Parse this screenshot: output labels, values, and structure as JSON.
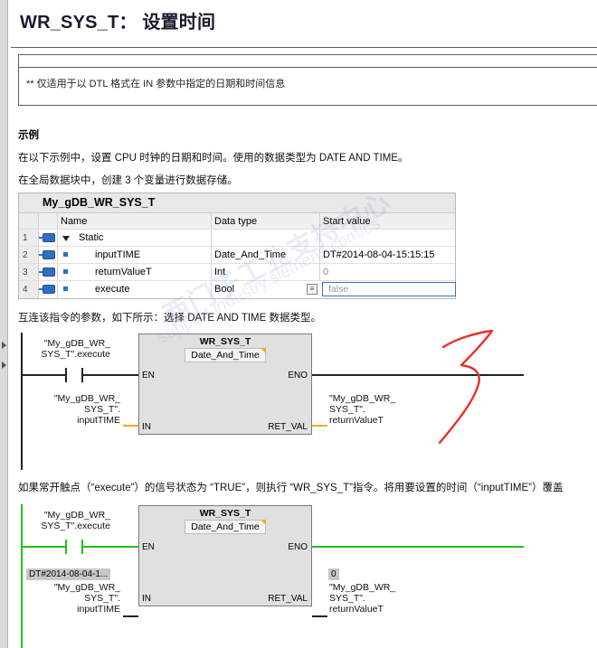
{
  "title": "WR_SYS_T： 设置时间",
  "note": "** 仅适用于以 DTL 格式在 IN 参数中指定的日期和时间信息",
  "example": {
    "heading": "示例",
    "line1": "在以下示例中，设置 CPU 时钟的日期和时间。使用的数据类型为 DATE AND TIME。",
    "line2": "在全局数据块中，创建 3 个变量进行数据存储。",
    "line3": "互连该指令的参数，如下所示：选择 DATE AND TIME 数据类型。",
    "line4": "如果常开触点（“execute”）的信号状态为 “TRUE”，则执行 “WR_SYS_T”指令。将用要设置的时间（“inputTIME”）覆盖"
  },
  "db_table": {
    "title": "My_gDB_WR_SYS_T",
    "columns": [
      "Name",
      "Data type",
      "Start value"
    ],
    "rows": [
      {
        "num": "1",
        "name": "Static",
        "type": "",
        "value": ""
      },
      {
        "num": "2",
        "name": "inputTIME",
        "type": "Date_And_Time",
        "value": "DT#2014-08-04-15:15:15"
      },
      {
        "num": "3",
        "name": "returnValueT",
        "type": "Int",
        "value": "0"
      },
      {
        "num": "4",
        "name": "execute",
        "type": "Bool",
        "value": "false"
      }
    ]
  },
  "ladder1": {
    "contact_label_1": "\"My_gDB_WR_",
    "contact_label_2": "SYS_T\".execute",
    "block_name": "WR_SYS_T",
    "block_type": "Date_And_Time",
    "pin_en": "EN",
    "pin_eno": "ENO",
    "pin_in": "IN",
    "pin_ret": "RET_VAL",
    "in_label_1": "\"My_gDB_WR_",
    "in_label_2": "SYS_T\".",
    "in_label_3": "inputTIME",
    "out_label_1": "\"My_gDB_WR_",
    "out_label_2": "SYS_T\".",
    "out_label_3": "returnValueT"
  },
  "ladder2": {
    "contact_label_1": "\"My_gDB_WR_",
    "contact_label_2": "SYS_T\".execute",
    "block_name": "WR_SYS_T",
    "block_type": "Date_And_Time",
    "pin_en": "EN",
    "pin_eno": "ENO",
    "pin_in": "IN",
    "pin_ret": "RET_VAL",
    "in_value": "DT#2014-08-04-1...",
    "in_label_1": "\"My_gDB_WR_",
    "in_label_2": "SYS_T\".",
    "in_label_3": "inputTIME",
    "out_value": "0",
    "out_label_1": "\"My_gDB_WR_",
    "out_label_2": "SYS_T\".",
    "out_label_3": "returnValueT"
  },
  "watermark": {
    "line1": "西门子工业支持中心",
    "line2": "support.industry.siemens.com/cs"
  },
  "colors": {
    "power_flow": "#21c21b",
    "db_icon": "#2f6fc4",
    "annotation_red": "#e8302a",
    "accent_orange": "#f5a623"
  }
}
